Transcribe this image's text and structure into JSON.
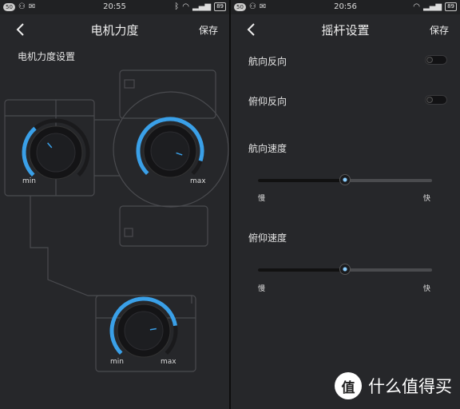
{
  "left": {
    "status": {
      "signal_badge": "50",
      "time": "20:55",
      "battery": "89"
    },
    "title": "电机力度",
    "save_label": "保存",
    "section_title": "电机力度设置",
    "knobs": [
      {
        "min_label": "min",
        "max_label": "",
        "level": 0.35
      },
      {
        "min_label": "",
        "max_label": "max",
        "level": 0.9
      },
      {
        "min_label": "min",
        "max_label": "max",
        "level": 0.8
      }
    ]
  },
  "right": {
    "status": {
      "signal_badge": "50",
      "time": "20:56",
      "battery": "89"
    },
    "title": "摇杆设置",
    "save_label": "保存",
    "toggles": [
      {
        "label": "航向反向",
        "on": false
      },
      {
        "label": "俯仰反向",
        "on": false
      }
    ],
    "sliders": [
      {
        "label": "航向速度",
        "slow_label": "慢",
        "fast_label": "快",
        "value": 0.5
      },
      {
        "label": "俯仰速度",
        "slow_label": "慢",
        "fast_label": "快",
        "value": 0.5
      }
    ]
  },
  "watermark": {
    "logo": "值",
    "text": "什么值得买"
  },
  "colors": {
    "accent": "#3aa0e8",
    "background": "#26272a"
  }
}
